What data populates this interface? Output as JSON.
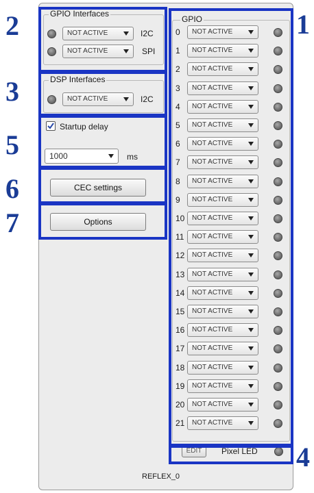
{
  "callouts": {
    "n1": "1",
    "n2": "2",
    "n3": "3",
    "n4": "4",
    "n5": "5",
    "n6": "6",
    "n7": "7"
  },
  "colors": {
    "callout": "#1a35c4",
    "panel": "#ececec"
  },
  "gpio_interfaces": {
    "title": "GPIO Interfaces",
    "rows": [
      {
        "value": "NOT ACTIVE",
        "label": "I2C"
      },
      {
        "value": "NOT ACTIVE",
        "label": "SPI"
      }
    ]
  },
  "dsp_interfaces": {
    "title": "DSP Interfaces",
    "rows": [
      {
        "value": "NOT ACTIVE",
        "label": "I2C"
      }
    ]
  },
  "startup": {
    "checkbox_label": "Startup delay",
    "checked": true,
    "delay_value": "1000",
    "unit": "ms"
  },
  "cec_button": "CEC settings",
  "options_button": "Options",
  "gpio": {
    "title": "GPIO",
    "pins": [
      {
        "num": "0",
        "value": "NOT ACTIVE"
      },
      {
        "num": "1",
        "value": "NOT ACTIVE"
      },
      {
        "num": "2",
        "value": "NOT ACTIVE"
      },
      {
        "num": "3",
        "value": "NOT ACTIVE"
      },
      {
        "num": "4",
        "value": "NOT ACTIVE"
      },
      {
        "num": "5",
        "value": "NOT ACTIVE"
      },
      {
        "num": "6",
        "value": "NOT ACTIVE"
      },
      {
        "num": "7",
        "value": "NOT ACTIVE"
      },
      {
        "num": "8",
        "value": "NOT ACTIVE"
      },
      {
        "num": "9",
        "value": "NOT ACTIVE"
      },
      {
        "num": "10",
        "value": "NOT ACTIVE"
      },
      {
        "num": "11",
        "value": "NOT ACTIVE"
      },
      {
        "num": "12",
        "value": "NOT ACTIVE"
      },
      {
        "num": "13",
        "value": "NOT ACTIVE"
      },
      {
        "num": "14",
        "value": "NOT ACTIVE"
      },
      {
        "num": "15",
        "value": "NOT ACTIVE"
      },
      {
        "num": "16",
        "value": "NOT ACTIVE"
      },
      {
        "num": "17",
        "value": "NOT ACTIVE"
      },
      {
        "num": "18",
        "value": "NOT ACTIVE"
      },
      {
        "num": "19",
        "value": "NOT ACTIVE"
      },
      {
        "num": "20",
        "value": "NOT ACTIVE"
      },
      {
        "num": "21",
        "value": "NOT ACTIVE"
      }
    ]
  },
  "pixel_led": {
    "edit_label": "EDIT",
    "label": "Pixel LED"
  },
  "footer": "REFLEX_0"
}
